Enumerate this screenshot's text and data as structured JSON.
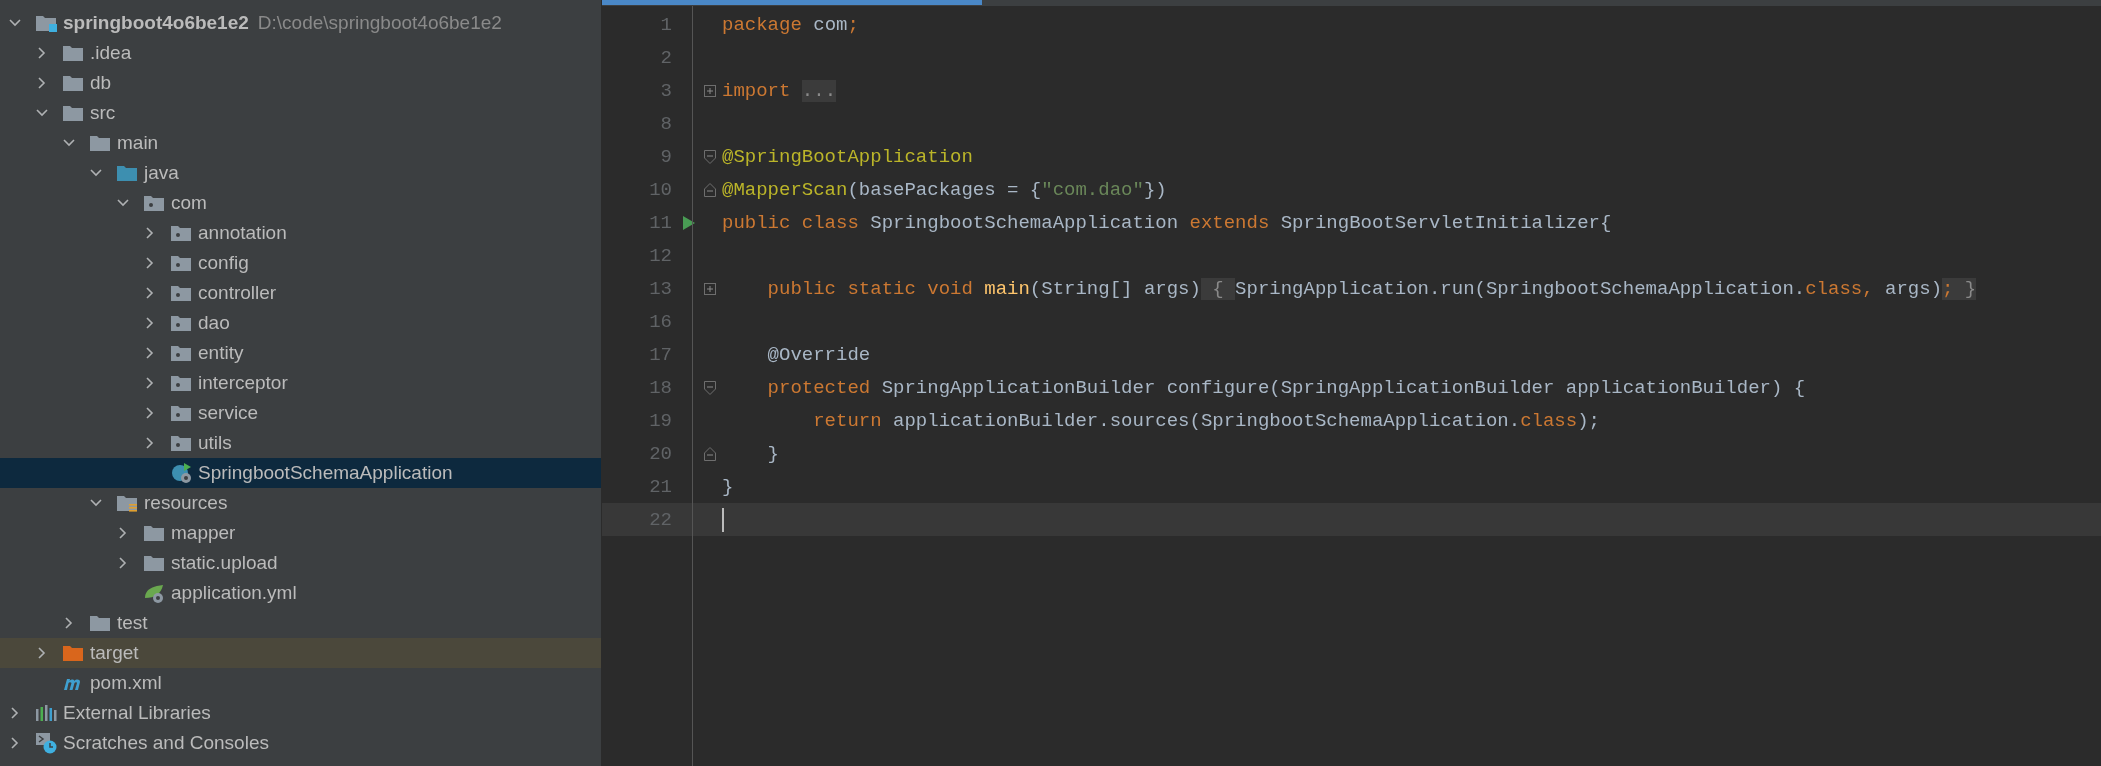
{
  "project_tree": [
    {
      "kind": "project",
      "label": "springboot4o6be1e2",
      "path": "D:\\code\\springboot4o6be1e2",
      "expanded": true,
      "selected": false,
      "children": [
        {
          "kind": "folder",
          "label": ".idea",
          "expanded": false,
          "selected": false
        },
        {
          "kind": "folder",
          "label": "db",
          "expanded": false,
          "selected": false
        },
        {
          "kind": "folder",
          "label": "src",
          "expanded": true,
          "selected": false,
          "children": [
            {
              "kind": "folder",
              "label": "main",
              "expanded": true,
              "selected": false,
              "children": [
                {
                  "kind": "source-root",
                  "label": "java",
                  "expanded": true,
                  "selected": false,
                  "children": [
                    {
                      "kind": "package",
                      "label": "com",
                      "expanded": true,
                      "selected": false,
                      "children": [
                        {
                          "kind": "package",
                          "label": "annotation",
                          "expanded": false,
                          "selected": false
                        },
                        {
                          "kind": "package",
                          "label": "config",
                          "expanded": false,
                          "selected": false
                        },
                        {
                          "kind": "package",
                          "label": "controller",
                          "expanded": false,
                          "selected": false
                        },
                        {
                          "kind": "package",
                          "label": "dao",
                          "expanded": false,
                          "selected": false
                        },
                        {
                          "kind": "package",
                          "label": "entity",
                          "expanded": false,
                          "selected": false
                        },
                        {
                          "kind": "package",
                          "label": "interceptor",
                          "expanded": false,
                          "selected": false
                        },
                        {
                          "kind": "package",
                          "label": "service",
                          "expanded": false,
                          "selected": false
                        },
                        {
                          "kind": "package",
                          "label": "utils",
                          "expanded": false,
                          "selected": false
                        },
                        {
                          "kind": "class",
                          "label": "SpringbootSchemaApplication",
                          "selected": true
                        }
                      ]
                    }
                  ]
                },
                {
                  "kind": "resources",
                  "label": "resources",
                  "expanded": true,
                  "selected": false,
                  "children": [
                    {
                      "kind": "folder",
                      "label": "mapper",
                      "expanded": false,
                      "selected": false
                    },
                    {
                      "kind": "folder",
                      "label": "static.upload",
                      "expanded": false,
                      "selected": false
                    },
                    {
                      "kind": "yml",
                      "label": "application.yml",
                      "selected": false
                    }
                  ]
                }
              ]
            },
            {
              "kind": "folder",
              "label": "test",
              "expanded": false,
              "selected": false
            }
          ]
        },
        {
          "kind": "excluded",
          "label": "target",
          "expanded": false,
          "selected": false
        },
        {
          "kind": "maven",
          "label": "pom.xml",
          "selected": false
        }
      ]
    },
    {
      "kind": "libraries",
      "label": "External Libraries",
      "expanded": false,
      "selected": false
    },
    {
      "kind": "scratches",
      "label": "Scratches and Consoles",
      "expanded": false,
      "selected": false
    }
  ],
  "editor": {
    "lines": [
      {
        "number": "1",
        "current": false,
        "kind": "plain",
        "tokens": [
          {
            "text": "package",
            "kind": "kw"
          },
          {
            "text": " com",
            "kind": "plain"
          },
          {
            "text": ";",
            "kind": "kw"
          }
        ]
      },
      {
        "number": "2",
        "current": false,
        "kind": "plain"
      },
      {
        "number": "3",
        "current": false,
        "kind": "expand",
        "tokens": [
          {
            "text": "import ",
            "kind": "kw"
          },
          {
            "text": "...",
            "kind": "fold"
          }
        ]
      },
      {
        "number": "8",
        "current": false,
        "kind": "plain"
      },
      {
        "number": "9",
        "current": false,
        "kind": "fold-start",
        "tokens": [
          {
            "text": "@SpringBootApplication",
            "kind": "ann"
          }
        ]
      },
      {
        "number": "10",
        "current": false,
        "kind": "fold-end",
        "tokens": [
          {
            "text": "@MapperScan",
            "kind": "ann"
          },
          {
            "text": "(basePackages = {",
            "kind": "plain"
          },
          {
            "text": "\"com.dao\"",
            "kind": "str"
          },
          {
            "text": "})",
            "kind": "plain"
          }
        ]
      },
      {
        "number": "11",
        "current": false,
        "kind": "run",
        "tokens": [
          {
            "text": "public class",
            "kind": "kw"
          },
          {
            "text": " SpringbootSchemaApplication ",
            "kind": "plain"
          },
          {
            "text": "extends",
            "kind": "kw"
          },
          {
            "text": " SpringBootServletInitializer{",
            "kind": "plain"
          }
        ]
      },
      {
        "number": "12",
        "current": false,
        "kind": "plain"
      },
      {
        "number": "13",
        "current": false,
        "kind": "expand",
        "tokens": [
          {
            "text": "    public static void ",
            "kind": "kw"
          },
          {
            "text": "main",
            "kind": "fn"
          },
          {
            "text": "(String[] args)",
            "kind": "plain"
          },
          {
            "text": " { ",
            "kind": "fold"
          },
          {
            "text": "SpringApplication.run(SpringbootSchemaApplication.",
            "kind": "plain"
          },
          {
            "text": "class,",
            "kind": "kw"
          },
          {
            "text": " args)",
            "kind": "plain"
          },
          {
            "text": ";",
            "kind": "fold-kw"
          },
          {
            "text": " }",
            "kind": "fold"
          }
        ]
      },
      {
        "number": "16",
        "current": false,
        "kind": "plain"
      },
      {
        "number": "17",
        "current": false,
        "kind": "plain",
        "tokens": [
          {
            "text": "    @Override",
            "kind": "ann-plain"
          }
        ]
      },
      {
        "number": "18",
        "current": false,
        "kind": "fold-start",
        "tokens": [
          {
            "text": "    protected",
            "kind": "kw"
          },
          {
            "text": " SpringApplicationBuilder configure(SpringApplicationBuilder applicationBuilder) {",
            "kind": "plain"
          }
        ]
      },
      {
        "number": "19",
        "current": false,
        "kind": "plain",
        "tokens": [
          {
            "text": "        return",
            "kind": "kw"
          },
          {
            "text": " applicationBuilder.sources(SpringbootSchemaApplication.",
            "kind": "plain"
          },
          {
            "text": "class",
            "kind": "kw"
          },
          {
            "text": ");",
            "kind": "plain"
          }
        ]
      },
      {
        "number": "20",
        "current": false,
        "kind": "fold-end",
        "tokens": [
          {
            "text": "    }",
            "kind": "plain"
          }
        ]
      },
      {
        "number": "21",
        "current": false,
        "kind": "plain",
        "tokens": [
          {
            "text": "}",
            "kind": "plain"
          }
        ]
      },
      {
        "number": "22",
        "current": true,
        "kind": "plain"
      }
    ]
  }
}
